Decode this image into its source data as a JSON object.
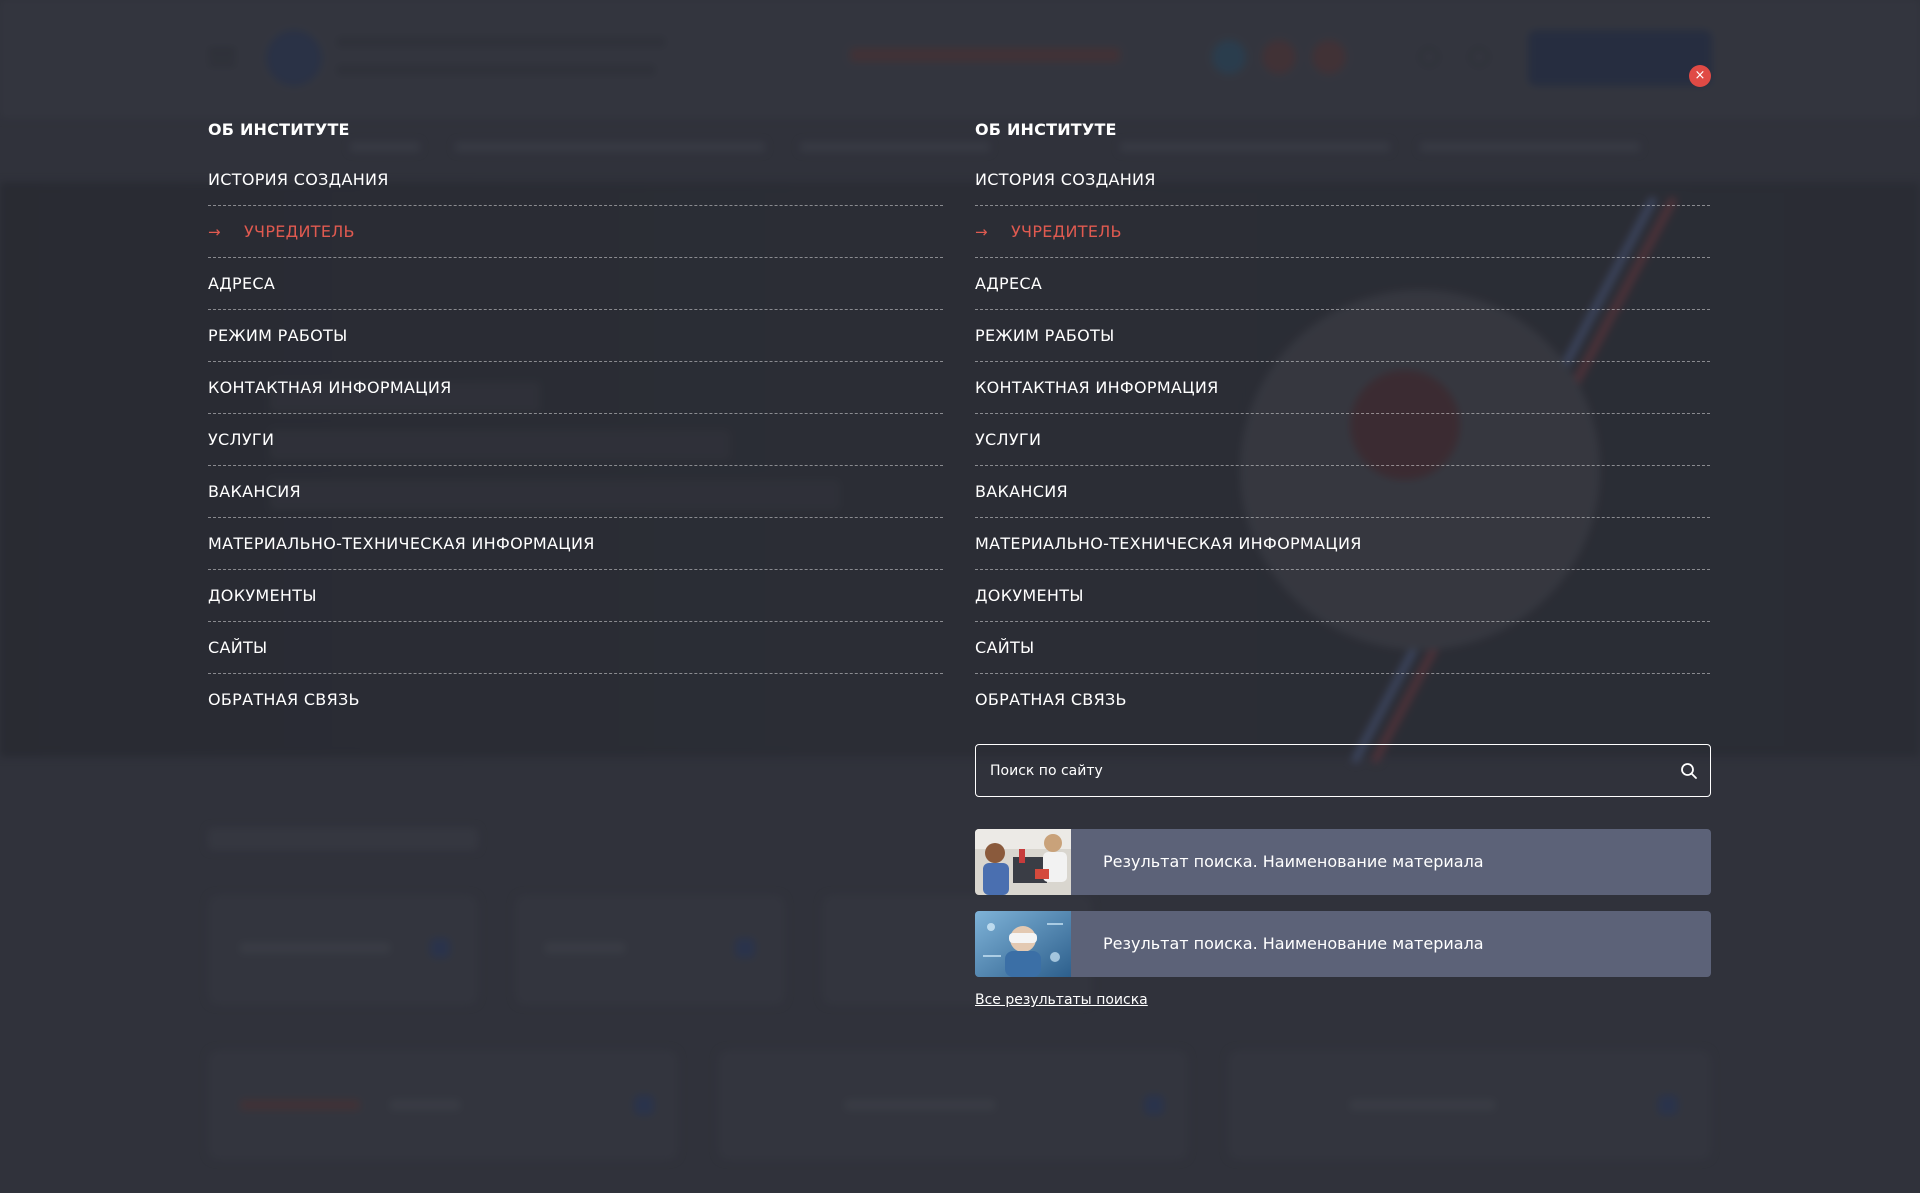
{
  "menu": {
    "columns": [
      {
        "title": "ОБ ИНСТИТУТЕ",
        "items": [
          {
            "label": "ИСТОРИЯ СОЗДАНИЯ",
            "active": false
          },
          {
            "label": "УЧРЕДИТЕЛЬ",
            "active": true
          },
          {
            "label": "АДРЕСА",
            "active": false
          },
          {
            "label": "РЕЖИМ РАБОТЫ",
            "active": false
          },
          {
            "label": "КОНТАКТНАЯ ИНФОРМАЦИЯ",
            "active": false
          },
          {
            "label": "УСЛУГИ",
            "active": false
          },
          {
            "label": "ВАКАНСИЯ",
            "active": false
          },
          {
            "label": "МАТЕРИАЛЬНО-ТЕХНИЧЕСКАЯ ИНФОРМАЦИЯ",
            "active": false
          },
          {
            "label": "ДОКУМЕНТЫ",
            "active": false
          },
          {
            "label": "САЙТЫ",
            "active": false
          },
          {
            "label": "ОБРАТНАЯ СВЯЗЬ",
            "active": false
          }
        ]
      },
      {
        "title": "ОБ ИНСТИТУТЕ",
        "items": [
          {
            "label": "ИСТОРИЯ СОЗДАНИЯ",
            "active": false
          },
          {
            "label": "УЧРЕДИТЕЛЬ",
            "active": true
          },
          {
            "label": "АДРЕСА",
            "active": false
          },
          {
            "label": "РЕЖИМ РАБОТЫ",
            "active": false
          },
          {
            "label": "КОНТАКТНАЯ ИНФОРМАЦИЯ",
            "active": false
          },
          {
            "label": "УСЛУГИ",
            "active": false
          },
          {
            "label": "ВАКАНСИЯ",
            "active": false
          },
          {
            "label": "МАТЕРИАЛЬНО-ТЕХНИЧЕСКАЯ ИНФОРМАЦИЯ",
            "active": false
          },
          {
            "label": "ДОКУМЕНТЫ",
            "active": false
          },
          {
            "label": "САЙТЫ",
            "active": false
          },
          {
            "label": "ОБРАТНАЯ СВЯЗЬ",
            "active": false
          }
        ]
      }
    ],
    "active_arrow": "→",
    "close_icon": "×"
  },
  "search": {
    "placeholder": "Поиск по сайту",
    "value": "",
    "icon": "search-icon",
    "results": [
      {
        "title": "Результат поиска. Наименование материала",
        "thumb": "children-robotics-photo"
      },
      {
        "title": "Результат поиска. Наименование материала",
        "thumb": "child-vr-photo"
      }
    ],
    "all_results_label": "Все результаты поиска"
  },
  "colors": {
    "accent_red": "#e05a50",
    "result_bg": "#5c6278",
    "close_bg": "#e04a45"
  }
}
